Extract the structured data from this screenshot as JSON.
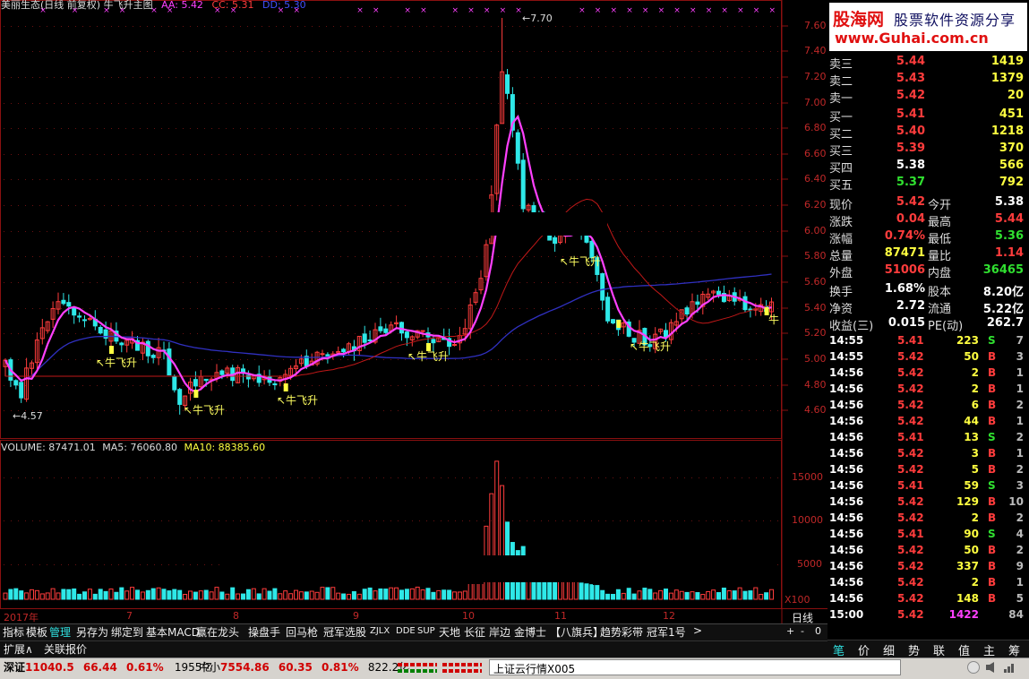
{
  "colors": {
    "up": "#ff3c3c",
    "down": "#2ee8e8",
    "ma5": "#ff40ff",
    "ma10": "#3030c0",
    "ma20": "#c01818",
    "vol_ma5": "#ffffff",
    "vol_ma10": "#ffff40",
    "grid": "#8a1010"
  },
  "chart_title": {
    "name": "美丽生态(日线 前复权) 牛飞升主图",
    "aa": "AA: 5.42",
    "cc": "CC: 5.31",
    "dd": "DD: 5.30"
  },
  "price_axis": [
    "7.60",
    "7.40",
    "7.20",
    "7.00",
    "6.80",
    "6.60",
    "6.40",
    "6.20",
    "6.00",
    "5.80",
    "5.60",
    "5.40",
    "5.20",
    "5.00",
    "4.80",
    "4.60"
  ],
  "volume_axis": [
    "15000",
    "10000",
    "5000",
    "X100"
  ],
  "high_label": "7.70",
  "low_label": "4.57",
  "signal_label": "牛飞升",
  "signal_short": "牛",
  "volume_title": {
    "v": "VOLUME: 87471.01",
    "ma5": "MA5: 76060.80",
    "ma10": "MA10: 88385.60"
  },
  "date_axis": [
    {
      "label": "2017年",
      "pos": 0
    },
    {
      "label": "7",
      "pos": 137
    },
    {
      "label": "8",
      "pos": 256
    },
    {
      "label": "9",
      "pos": 390
    },
    {
      "label": "10",
      "pos": 512
    },
    {
      "label": "11",
      "pos": 615
    },
    {
      "label": "12",
      "pos": 736
    }
  ],
  "brand": {
    "logo": "股海网",
    "tagline": "股票软件资源分享",
    "url": "www.Guhai.com.cn"
  },
  "order_book": [
    {
      "label": "卖三",
      "price": "5.44",
      "vol": "1419",
      "pc": "#ff3c3c",
      "vc": "#ffff40"
    },
    {
      "label": "卖二",
      "price": "5.43",
      "vol": "1379",
      "pc": "#ff3c3c",
      "vc": "#ffff40"
    },
    {
      "label": "卖一",
      "price": "5.42",
      "vol": "20",
      "pc": "#ff3c3c",
      "vc": "#ffff40"
    },
    {
      "label": "买一",
      "price": "5.41",
      "vol": "451",
      "pc": "#ff3c3c",
      "vc": "#ffff40"
    },
    {
      "label": "买二",
      "price": "5.40",
      "vol": "1218",
      "pc": "#ff3c3c",
      "vc": "#ffff40"
    },
    {
      "label": "买三",
      "price": "5.39",
      "vol": "370",
      "pc": "#ff3c3c",
      "vc": "#ffff40"
    },
    {
      "label": "买四",
      "price": "5.38",
      "vol": "566",
      "pc": "#ffffff",
      "vc": "#ffff40"
    },
    {
      "label": "买五",
      "price": "5.37",
      "vol": "792",
      "pc": "#30e030",
      "vc": "#ffff40"
    }
  ],
  "quote": [
    {
      "l1": "现价",
      "v1": "5.42",
      "c1": "#ff3c3c",
      "l2": "今开",
      "v2": "5.38",
      "c2": "#ffffff"
    },
    {
      "l1": "涨跌",
      "v1": "0.04",
      "c1": "#ff3c3c",
      "l2": "最高",
      "v2": "5.44",
      "c2": "#ff3c3c"
    },
    {
      "l1": "涨幅",
      "v1": "0.74%",
      "c1": "#ff3c3c",
      "l2": "最低",
      "v2": "5.36",
      "c2": "#30e030"
    },
    {
      "l1": "总量",
      "v1": "87471",
      "c1": "#ffff40",
      "l2": "量比",
      "v2": "1.14",
      "c2": "#ff3c3c"
    },
    {
      "l1": "外盘",
      "v1": "51006",
      "c1": "#ff3c3c",
      "l2": "内盘",
      "v2": "36465",
      "c2": "#30e030"
    }
  ],
  "finance": [
    {
      "l1": "换手",
      "v1": "1.68%",
      "l2": "股本",
      "v2": "8.20亿"
    },
    {
      "l1": "净资",
      "v1": "2.72",
      "l2": "流通",
      "v2": "5.22亿"
    },
    {
      "l1": "收益(三)",
      "v1": "0.015",
      "l2": "PE(动)",
      "v2": "262.7"
    }
  ],
  "ticks": [
    {
      "t": "14:55",
      "p": "5.41",
      "v": "223",
      "s": "S",
      "n": "7"
    },
    {
      "t": "14:55",
      "p": "5.42",
      "v": "50",
      "s": "B",
      "n": "3"
    },
    {
      "t": "14:56",
      "p": "5.42",
      "v": "2",
      "s": "B",
      "n": "1"
    },
    {
      "t": "14:56",
      "p": "5.42",
      "v": "2",
      "s": "B",
      "n": "1"
    },
    {
      "t": "14:56",
      "p": "5.42",
      "v": "6",
      "s": "B",
      "n": "2"
    },
    {
      "t": "14:56",
      "p": "5.42",
      "v": "44",
      "s": "B",
      "n": "1"
    },
    {
      "t": "14:56",
      "p": "5.41",
      "v": "13",
      "s": "S",
      "n": "2"
    },
    {
      "t": "14:56",
      "p": "5.42",
      "v": "3",
      "s": "B",
      "n": "1"
    },
    {
      "t": "14:56",
      "p": "5.42",
      "v": "5",
      "s": "B",
      "n": "2"
    },
    {
      "t": "14:56",
      "p": "5.41",
      "v": "59",
      "s": "S",
      "n": "3"
    },
    {
      "t": "14:56",
      "p": "5.42",
      "v": "129",
      "s": "B",
      "n": "10"
    },
    {
      "t": "14:56",
      "p": "5.42",
      "v": "2",
      "s": "B",
      "n": "2"
    },
    {
      "t": "14:56",
      "p": "5.41",
      "v": "90",
      "s": "S",
      "n": "4"
    },
    {
      "t": "14:56",
      "p": "5.42",
      "v": "50",
      "s": "B",
      "n": "2"
    },
    {
      "t": "14:56",
      "p": "5.42",
      "v": "337",
      "s": "B",
      "n": "9"
    },
    {
      "t": "14:56",
      "p": "5.42",
      "v": "2",
      "s": "B",
      "n": "1"
    },
    {
      "t": "14:56",
      "p": "5.42",
      "v": "148",
      "s": "B",
      "n": "5"
    },
    {
      "t": "15:00",
      "p": "5.42",
      "v": "1422",
      "s": "",
      "n": "84"
    }
  ],
  "bottom_tabs": [
    "指标",
    "模板",
    "管理",
    "另存为",
    "绑定到",
    "基本MACD",
    "赢在龙头",
    "操盘手",
    "回马枪",
    "冠军选股",
    "ZJLX",
    "DDE",
    "SUP",
    "天地",
    "长征",
    "岸边",
    "金博士",
    "【八旗兵】",
    "趋势彩带",
    "冠军1号",
    ">"
  ],
  "period": "日线",
  "period_ctrl": [
    "+",
    "-",
    "0"
  ],
  "expand_tabs": [
    "扩展∧",
    "关联报价"
  ],
  "right_tabs": [
    "笔",
    "价",
    "细",
    "势",
    "联",
    "值",
    "主",
    "筹"
  ],
  "status": {
    "sz_label": "深证",
    "sz_val": "11040.5",
    "sz_chg": "66.44",
    "sz_pct": "0.61%",
    "sz_amt": "1955亿",
    "zx_label": "中小",
    "zx_val": "7554.86",
    "zx_chg": "60.35",
    "zx_pct": "0.81%",
    "zx_amt": "822.2亿",
    "news": "上证云行情X005"
  }
}
